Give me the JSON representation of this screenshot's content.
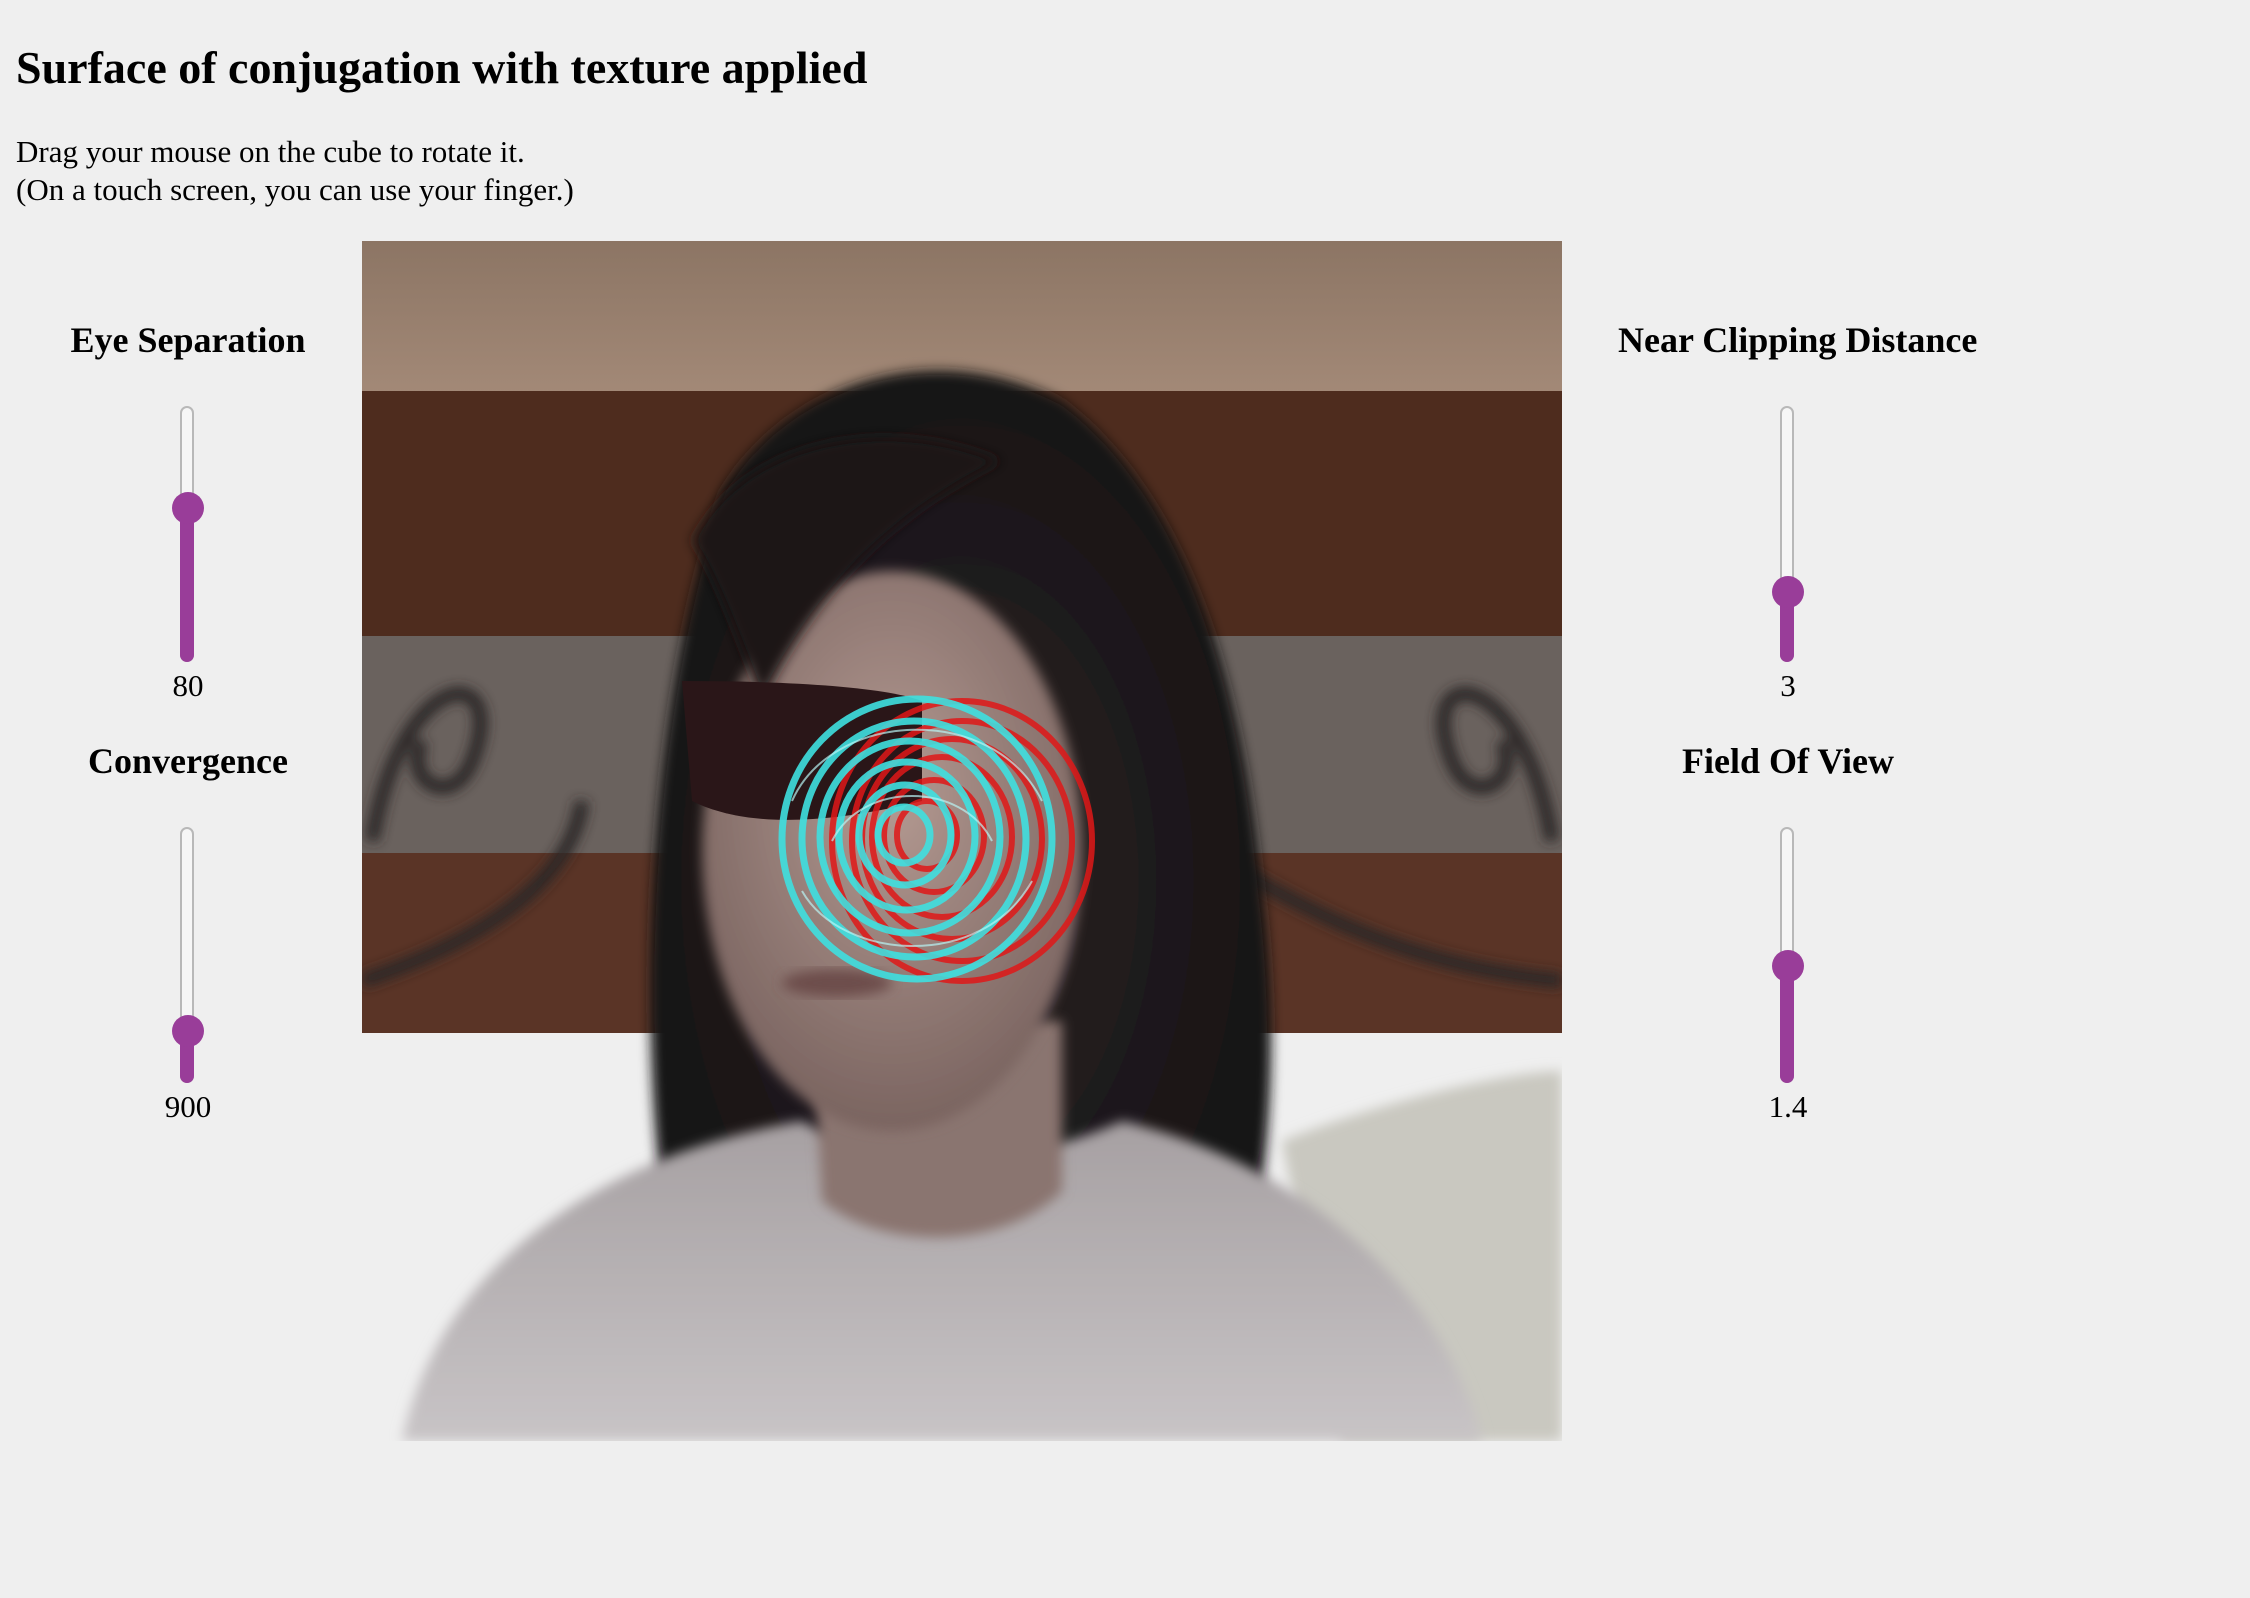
{
  "page": {
    "title": "Surface of conjugation with texture applied",
    "instructions": [
      "Drag your mouse on the cube to rotate it.",
      "(On a touch screen, you can use your finger.)"
    ]
  },
  "controls": {
    "eye_separation": {
      "label": "Eye Separation",
      "value": "80",
      "fraction": 0.62
    },
    "convergence": {
      "label": "Convergence",
      "value": "900",
      "fraction": 0.15
    },
    "near_clipping": {
      "label": "Near Clipping Distance",
      "value": "3",
      "fraction": 0.23
    },
    "field_of_view": {
      "label": "Field Of View",
      "value": "1.4",
      "fraction": 0.45
    }
  },
  "colors": {
    "slider_accent": "#993d99",
    "background": "#efefef",
    "anaglyph_red": "#e01818",
    "anaglyph_cyan": "#3fe0e0"
  }
}
